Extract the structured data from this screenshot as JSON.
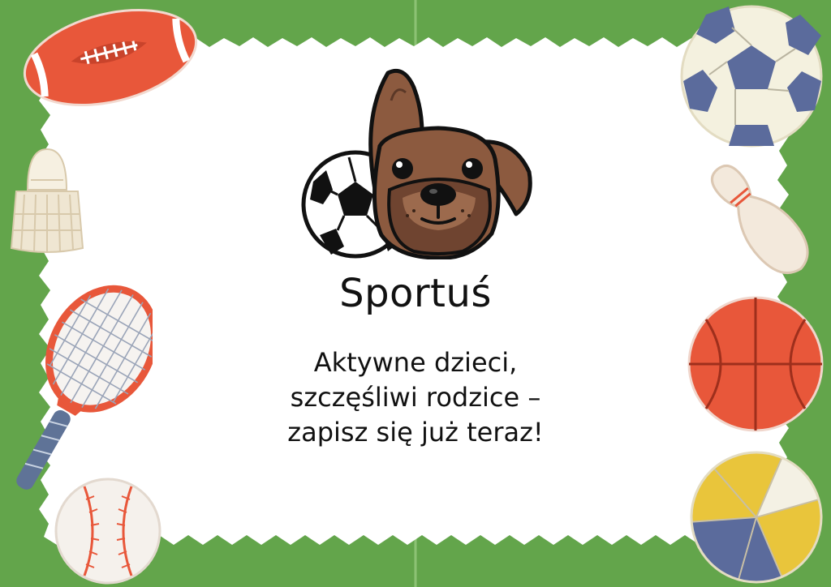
{
  "flyer": {
    "title": "Sportuś",
    "slogan_lines": [
      "Aktywne dzieci,",
      "szczęśliwi rodzice –",
      "zapisz się już teraz!"
    ]
  },
  "colors": {
    "grass": "#63a54b",
    "card": "#ffffff",
    "dog_fur": "#8c5a3f",
    "ball_red": "#e8573a",
    "volleyball_yellow": "#e9c53b",
    "soccer_patch": "#5b6b9c"
  },
  "decorations": [
    "american-football-icon",
    "soccer-ball-icon",
    "shuttlecock-icon",
    "bowling-pin-icon",
    "tennis-racket-icon",
    "basketball-icon",
    "baseball-icon",
    "volleyball-icon",
    "dog-with-ball-logo"
  ]
}
